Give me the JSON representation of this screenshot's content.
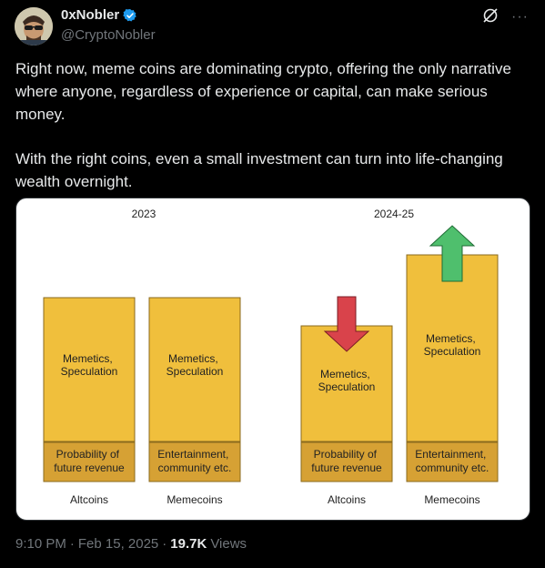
{
  "author": {
    "display_name": "0xNobler",
    "handle": "@CryptoNobler",
    "verified": true
  },
  "actions": {
    "grok_icon": "grok-icon",
    "more_icon": "more-icon",
    "more_label": "···"
  },
  "tweet": {
    "paragraphs": [
      "Right now, meme coins are dominating crypto, offering the only narrative where anyone, regardless of experience or capital, can make serious money.",
      "With the right coins, even a small investment can turn into life-changing wealth overnight."
    ]
  },
  "image": {
    "panels": [
      {
        "year": "2023",
        "bars": [
          {
            "category": "Altcoins",
            "top": "Memetics,\nSpeculation",
            "bottom": "Probability of\nfuture revenue"
          },
          {
            "category": "Memecoins",
            "top": "Memetics,\nSpeculation",
            "bottom": "Entertainment,\ncommunity etc."
          }
        ]
      },
      {
        "year": "2024-25",
        "bars": [
          {
            "category": "Altcoins",
            "top": "Memetics,\nSpeculation",
            "bottom": "Probability of\nfuture revenue",
            "arrow": "down"
          },
          {
            "category": "Memecoins",
            "top": "Memetics,\nSpeculation",
            "bottom": "Entertainment,\ncommunity etc.",
            "arrow": "up"
          }
        ]
      }
    ],
    "colors": {
      "bar_fill": "#f0bf3c",
      "bar_bottom_fill": "#d6a134",
      "bar_stroke": "#8a6a1e",
      "arrow_down": "#d9434b",
      "arrow_up": "#4fbf6d"
    }
  },
  "meta": {
    "time": "9:10 PM",
    "separator": "·",
    "date": "Feb 15, 2025",
    "views_count": "19.7K",
    "views_label": "Views"
  }
}
